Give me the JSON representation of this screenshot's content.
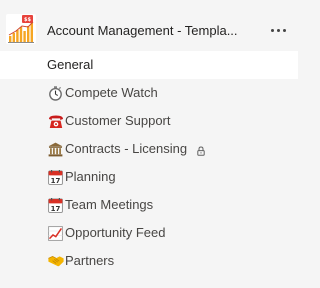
{
  "team": {
    "name": "Account Management - Templa...",
    "avatar_icon": "sales-chart-icon",
    "more_icon": "more-options-icon"
  },
  "channels": [
    {
      "label": "General",
      "icon": null,
      "selected": true
    },
    {
      "label": "Compete Watch",
      "icon": "stopwatch-icon"
    },
    {
      "label": "Customer Support",
      "icon": "telephone-icon"
    },
    {
      "label": "Contracts - Licensing",
      "icon": "classical-building-icon",
      "private": true,
      "private_icon": "lock-icon"
    },
    {
      "label": "Planning",
      "icon": "calendar-icon"
    },
    {
      "label": "Team Meetings",
      "icon": "calendar-icon"
    },
    {
      "label": "Opportunity Feed",
      "icon": "chart-increasing-icon"
    },
    {
      "label": "Partners",
      "icon": "handshake-icon"
    }
  ],
  "colors": {
    "background": "#f5f5f5",
    "selected_background": "#ffffff",
    "text_primary": "#252423",
    "text_secondary": "#484644"
  }
}
